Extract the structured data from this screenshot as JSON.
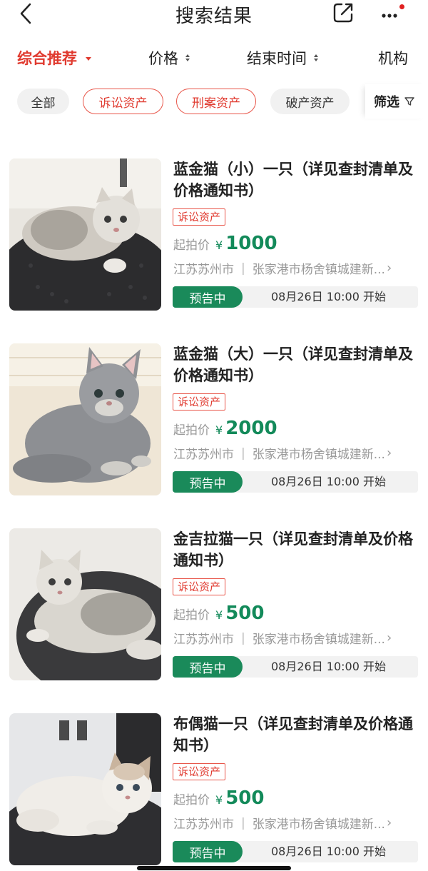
{
  "header": {
    "title": "搜索结果"
  },
  "sort": {
    "items": [
      "综合推荐",
      "价格",
      "结束时间",
      "机构"
    ]
  },
  "filters": {
    "chips": [
      "全部",
      "诉讼资产",
      "刑案资产",
      "破产资产"
    ],
    "filter_label": "筛选"
  },
  "items": [
    {
      "title": "蓝金猫（小）一只（详见查封清单及价格通知书）",
      "tag": "诉讼资产",
      "price_label": "起拍价",
      "currency": "¥",
      "price": "1000",
      "city": "江苏苏州市",
      "address": "张家港市杨舍镇城建新...",
      "status": "预告中",
      "start_time": "08月26日 10:00 开始",
      "photo": "silver-chinchilla-kitten-photo"
    },
    {
      "title": "蓝金猫（大）一只（详见查封清单及价格通知书）",
      "tag": "诉讼资产",
      "price_label": "起拍价",
      "currency": "¥",
      "price": "2000",
      "city": "江苏苏州市",
      "address": "张家港市杨舍镇城建新...",
      "status": "预告中",
      "start_time": "08月26日 10:00 开始",
      "photo": "blue-golden-cat-photo"
    },
    {
      "title": "金吉拉猫一只（详见查封清单及价格通知书）",
      "tag": "诉讼资产",
      "price_label": "起拍价",
      "currency": "¥",
      "price": "500",
      "city": "江苏苏州市",
      "address": "张家港市杨舍镇城建新...",
      "status": "预告中",
      "start_time": "08月26日 10:00 开始",
      "photo": "chinchilla-cat-photo"
    },
    {
      "title": "布偶猫一只（详见查封清单及价格通知书）",
      "tag": "诉讼资产",
      "price_label": "起拍价",
      "currency": "¥",
      "price": "500",
      "city": "江苏苏州市",
      "address": "张家港市杨舍镇城建新...",
      "status": "预告中",
      "start_time": "08月26日 10:00 开始",
      "photo": "ragdoll-cat-photo"
    }
  ],
  "colors": {
    "accent_red": "#e03a2f",
    "price_green": "#138a5a",
    "status_green": "#1a8a5a"
  }
}
